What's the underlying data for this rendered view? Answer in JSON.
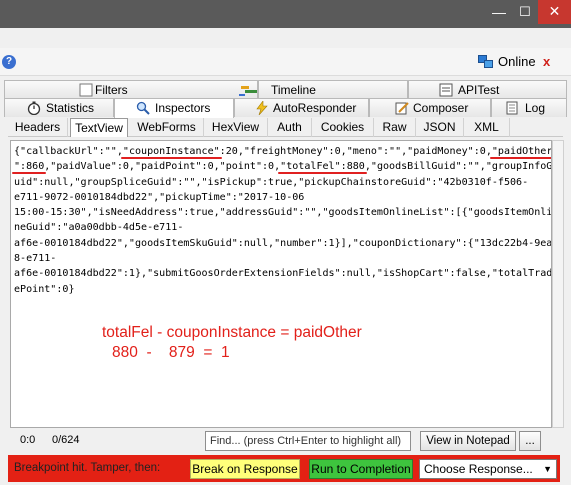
{
  "window": {
    "minimize": "—",
    "maximize": "☐",
    "close": "✕"
  },
  "help_icon": "?",
  "online": {
    "label": "Online",
    "close": "x"
  },
  "tabs_row1": {
    "filters": "Filters",
    "timeline": "Timeline",
    "apitest": "APITest"
  },
  "tabs_row2": {
    "statistics": "Statistics",
    "inspectors": "Inspectors",
    "autoresponder": "AutoResponder",
    "composer": "Composer",
    "log": "Log"
  },
  "subtabs": [
    "Headers",
    "TextView",
    "WebForms",
    "HexView",
    "Auth",
    "Cookies",
    "Raw",
    "JSON",
    "XML"
  ],
  "subtab_active": "TextView",
  "body_lines": [
    [
      {
        "t": "{\"callbackUrl\":\"\","
      },
      {
        "t": "\"couponInstance\"",
        "u": true
      },
      {
        "t": ":20,\"freightMoney\":0,\"meno\":\"\",\"paidMoney\":0,"
      },
      {
        "t": "\"paidOther",
        "u": true
      }
    ],
    [
      {
        "t": "\":860",
        "u": true
      },
      {
        "t": ",\"paidValue\":0,\"paidPoint\":0,\"point\":0,"
      },
      {
        "t": "\"totalFel\":880",
        "u": true
      },
      {
        "t": ",\"goodsBillGuid\":\"\",\"groupInfoG"
      }
    ],
    [
      {
        "t": "uid\":null,\"groupSpliceGuid\":\"\",\"isPickup\":true,\"pickupChainstoreGuid\":\"42b0310f-f506-"
      }
    ],
    [
      {
        "t": "e711-9072-0010184dbd22\",\"pickupTime\":\"2017-10-06"
      }
    ],
    [
      {
        "t": "15:00-15:30\",\"isNeedAddress\":true,\"addressGuid\":\"\",\"goodsItemOnlineList\":[{\"goodsItemOnli"
      }
    ],
    [
      {
        "t": "neGuid\":\"a0a00dbb-4d5e-e711-"
      }
    ],
    [
      {
        "t": "af6e-0010184dbd22\",\"goodsItemSkuGuid\":null,\"number\":1}],\"couponDictionary\":{\"13dc22b4-9ea"
      }
    ],
    [
      {
        "t": "8-e711-"
      }
    ],
    [
      {
        "t": "af6e-0010184dbd22\":1},\"submitGoosOrderExtensionFields\":null,\"isShopCart\":false,\"totalTrade"
      }
    ],
    [
      {
        "t": "ePoint\":0}"
      }
    ]
  ],
  "annotation": {
    "equation": "totalFel - couponInstance = paidOther",
    "numbers": "880  -    879  =  1"
  },
  "status": {
    "cursor": "0:0",
    "count": "0/624",
    "find_placeholder": "Find... (press Ctrl+Enter to highlight all)",
    "view_in_notepad": "View in Notepad",
    "more": "..."
  },
  "breakpoint": {
    "label": "Breakpoint hit. Tamper, then:",
    "break_on_response": "Break on Response",
    "run_to_completion": "Run to Completion",
    "choose_response": "Choose Response...",
    "color_bar": "#e32114",
    "color_break": "#ffff7a",
    "color_run": "#3ec43e"
  }
}
